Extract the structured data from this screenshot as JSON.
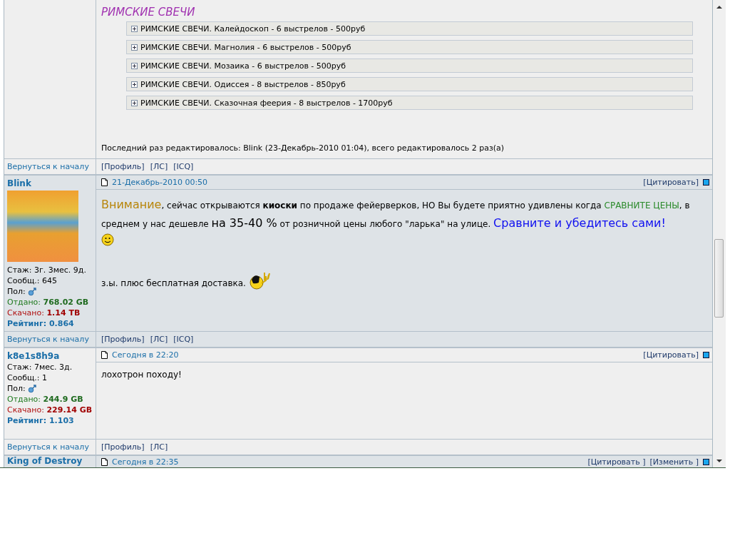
{
  "posts": [
    {
      "kind": "continued",
      "shaded": false,
      "heading": "РИМСКИЕ СВЕЧИ",
      "spoilers": [
        "РИМСКИЕ СВЕЧИ. Калейдоскоп - 6 выстрелов - 500руб",
        "РИМСКИЕ СВЕЧИ. Магнолия - 6 выстрелов - 500руб",
        "РИМСКИЕ СВЕЧИ. Мозаика - 6 выстрелов - 500руб",
        "РИМСКИЕ СВЕЧИ. Одиссея - 8 выстрелов - 850руб",
        "РИМСКИЕ СВЕЧИ. Сказочная феерия - 8 выстрелов - 1700руб"
      ],
      "edit_note": "Последний раз редактировалось: Blink (23-Декабрь-2010 01:04), всего редактировалось 2 раз(а)",
      "footer": {
        "back_link": "Вернуться к началу",
        "links": [
          "[Профиль]",
          "[ЛС]",
          "[ICQ]"
        ]
      }
    },
    {
      "kind": "full",
      "shaded": true,
      "author": {
        "name": "Blink",
        "avatar": true,
        "stats": [
          "Стаж: 3г. 3мес. 9д.",
          "Сообщ.: 645"
        ],
        "gender_label": "Пол:",
        "uploaded": "Отдано: **768.02 GB**",
        "downloaded": "Скачано: **1.14 TB**",
        "rating": "Рейтинг: 0.864"
      },
      "date": "21-Декабрь-2010 00:50",
      "actions": [
        "[Цитировать]"
      ],
      "paragraphs": [
        {
          "kind": "text",
          "segments": [
            {
              "kind": "accent",
              "text": "Внимание"
            },
            {
              "kind": "plain",
              "text": ", сейчас открываются "
            },
            {
              "kind": "bold",
              "text": "киоски"
            },
            {
              "kind": "plain",
              "text": " по продаже фейерверков, НО Вы будете приятно удивлены когда "
            },
            {
              "kind": "green",
              "text": "СРАВНИТЕ ЦЕНЫ"
            },
            {
              "kind": "plain",
              "text": ", в среднем у нас дешевле "
            },
            {
              "kind": "large",
              "text": "на 35-40 %"
            },
            {
              "kind": "plain",
              "text": " от розничной цены любого \"ларька\" на улице. "
            },
            {
              "kind": "blue-large",
              "text": "Сравните и убедитесь сами!"
            }
          ]
        },
        {
          "kind": "smiley"
        },
        {
          "kind": "text",
          "segments": [
            {
              "kind": "plain",
              "text": "з.ы. плюс бесплатная доставка."
            }
          ]
        },
        {
          "kind": "rocker-smiley"
        }
      ],
      "footer": {
        "back_link": "Вернуться к началу",
        "links": [
          "[Профиль]",
          "[ЛС]",
          "[ICQ]"
        ]
      }
    },
    {
      "kind": "full",
      "shaded": false,
      "author": {
        "name": "k8e1s8h9a",
        "avatar": false,
        "stats": [
          "Стаж: 7мес. 3д.",
          "Сообщ.: 1"
        ],
        "gender_label": "Пол:",
        "uploaded": "Отдано: **244.9 GB**",
        "downloaded": "Скачано: **229.14 GB**",
        "rating": "Рейтинг: 1.103"
      },
      "date": "Сегодня в 22:20",
      "actions": [
        "[Цитировать]"
      ],
      "paragraphs": [
        {
          "kind": "text",
          "segments": [
            {
              "kind": "plain",
              "text": "лохотрон походу!"
            }
          ]
        }
      ],
      "footer": {
        "back_link": "Вернуться к началу",
        "links": [
          "[Профиль]",
          "[ЛС]"
        ]
      }
    },
    {
      "kind": "partial",
      "shaded": true,
      "author": {
        "name": "King of Destroy"
      },
      "date": "Сегодня в 22:35",
      "actions": [
        "[Цитировать ]",
        "[Изменить ]"
      ]
    }
  ]
}
